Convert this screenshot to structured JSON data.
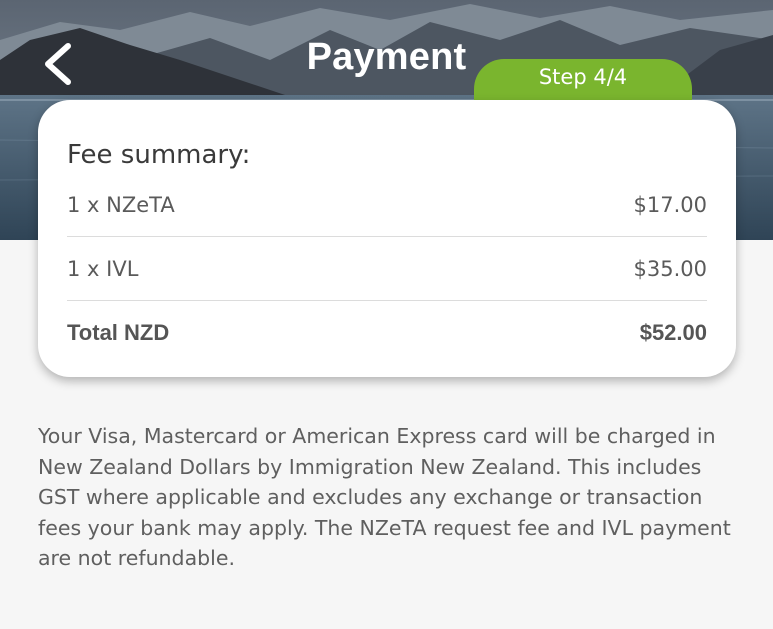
{
  "header": {
    "title": "Payment",
    "step": "Step 4/4",
    "back_icon": "chevron-left-icon"
  },
  "fee_summary": {
    "title": "Fee summary:",
    "items": [
      {
        "label": "1 x NZeTA",
        "amount": "$17.00"
      },
      {
        "label": "1 x IVL",
        "amount": "$35.00"
      }
    ],
    "total": {
      "label": "Total NZD",
      "amount": "$52.00"
    }
  },
  "disclaimer": "Your Visa, Mastercard or American Express card will be charged in New Zealand Dollars by Immigration New Zealand. This includes GST where applicable and excludes any exchange or transaction fees your bank may apply. The NZeTA request fee and IVL payment are not refundable.",
  "colors": {
    "accent_green": "#7ab52e",
    "background": "#f6f6f6",
    "text_gray": "#5f5f5f"
  }
}
